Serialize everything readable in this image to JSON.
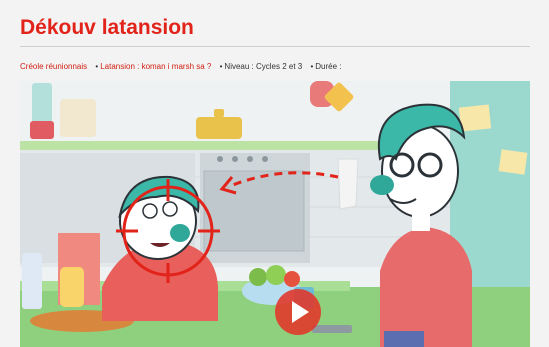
{
  "page": {
    "title": "Dékouv latansion"
  },
  "meta": {
    "language_link": "Créole réunionnais",
    "episode_link": "Latansion : koman i marsh sa ?",
    "level": "Niveau : Cycles 2 et 3",
    "duration": "Durée :"
  },
  "video": {
    "play_icon": "play-icon",
    "accent_color": "#e2231a"
  }
}
